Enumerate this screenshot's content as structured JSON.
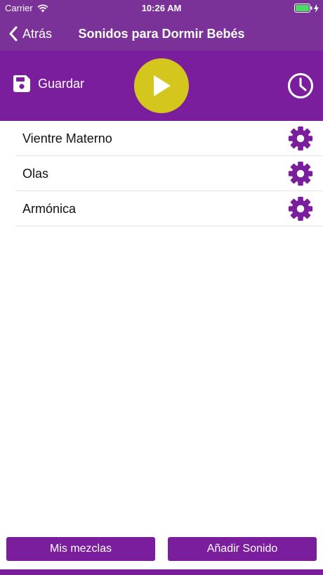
{
  "status_bar": {
    "carrier": "Carrier",
    "time": "10:26 AM",
    "wifi_icon": "wifi-icon",
    "battery_icon": "battery-icon"
  },
  "nav": {
    "back_label": "Atrás",
    "title": "Sonidos para Dormir Bebés"
  },
  "toolbar": {
    "save_label": "Guardar",
    "save_icon": "floppy-disk-icon",
    "play_icon": "play-icon",
    "timer_icon": "clock-icon"
  },
  "sounds": [
    {
      "label": "Vientre Materno",
      "icon": "gear-icon"
    },
    {
      "label": "Olas",
      "icon": "gear-icon"
    },
    {
      "label": "Armónica",
      "icon": "gear-icon"
    }
  ],
  "footer": {
    "my_mixes_label": "Mis mezclas",
    "add_sound_label": "Añadir Sonido"
  },
  "colors": {
    "brand_purple": "#7b1e9e",
    "nav_purple": "#7a3198",
    "play_yellow": "#d4c61c",
    "battery_green": "#4cd964"
  }
}
